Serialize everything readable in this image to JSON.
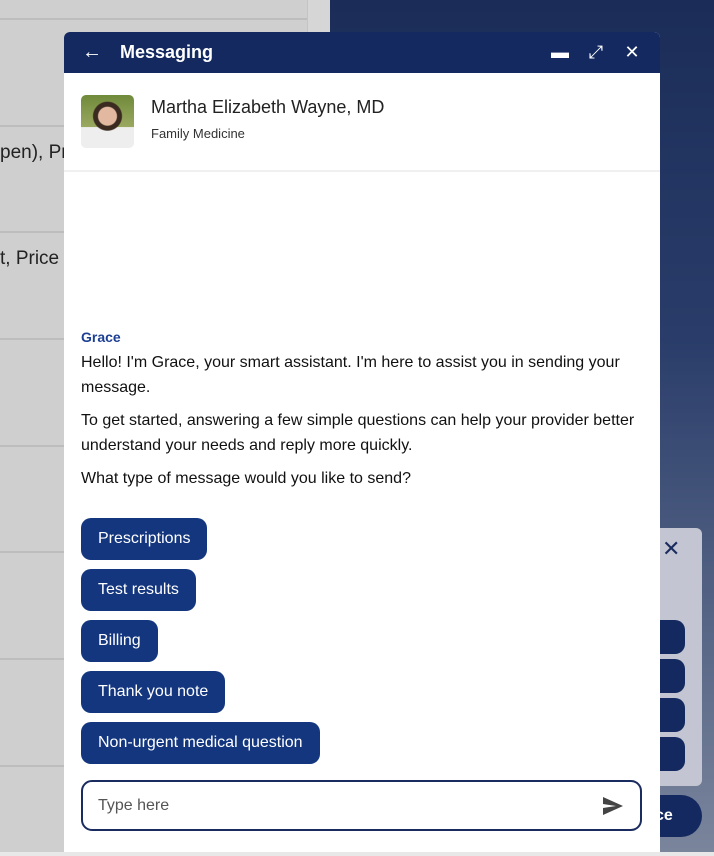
{
  "background": {
    "row_texts": [
      "pen), Pr",
      "t, Price"
    ],
    "behind_pill_text": "ce"
  },
  "modal": {
    "title": "Messaging",
    "provider": {
      "name": "Martha Elizabeth Wayne, MD",
      "specialty": "Family Medicine"
    },
    "sender": "Grace",
    "messages": [
      "Hello! I'm Grace, your smart assistant. I'm here to assist you in sending your message.",
      "To get started, answering a few simple questions can help your provider better understand your needs and reply more quickly.",
      "What type of message would you like to send?"
    ],
    "options": [
      "Prescriptions",
      "Test results",
      "Billing",
      "Thank you note",
      "Non-urgent medical question"
    ],
    "input_placeholder": "Type here",
    "colors": {
      "header": "#13295f",
      "option": "#13367f",
      "sender": "#1c3f94"
    }
  }
}
